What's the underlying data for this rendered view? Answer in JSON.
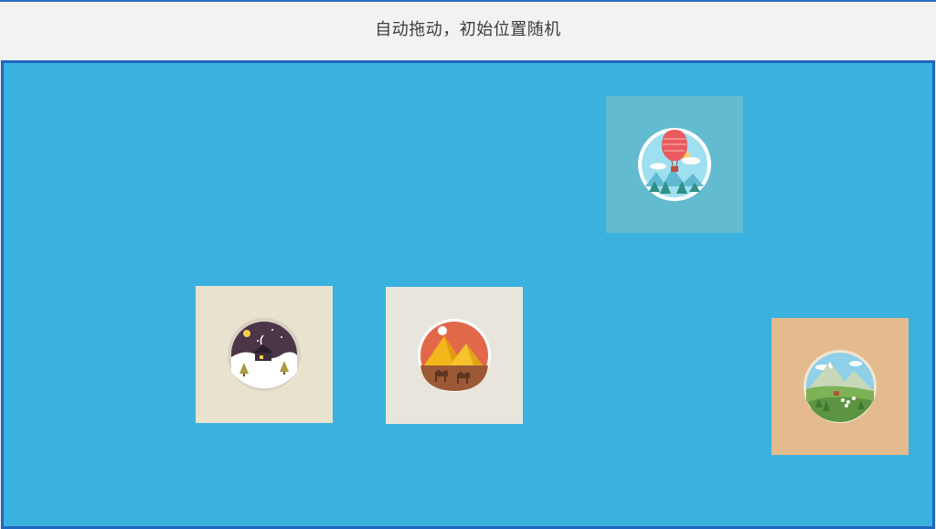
{
  "header": {
    "title": "自动拖动，初始位置随机"
  },
  "tiles": [
    {
      "name": "balloon-tile",
      "icon": "hot-air-balloon-icon",
      "bg": "#63bbd0"
    },
    {
      "name": "winter-tile",
      "icon": "winter-house-icon",
      "bg": "#e9e2ce"
    },
    {
      "name": "desert-tile",
      "icon": "desert-pyramids-icon",
      "bg": "#e8e6dc"
    },
    {
      "name": "mountain-tile",
      "icon": "mountain-meadow-icon",
      "bg": "#e4bb8e"
    }
  ],
  "colors": {
    "stage_bg": "#3bb1e0",
    "stage_border": "#2166c1",
    "top_rule": "#2a6fc4"
  }
}
